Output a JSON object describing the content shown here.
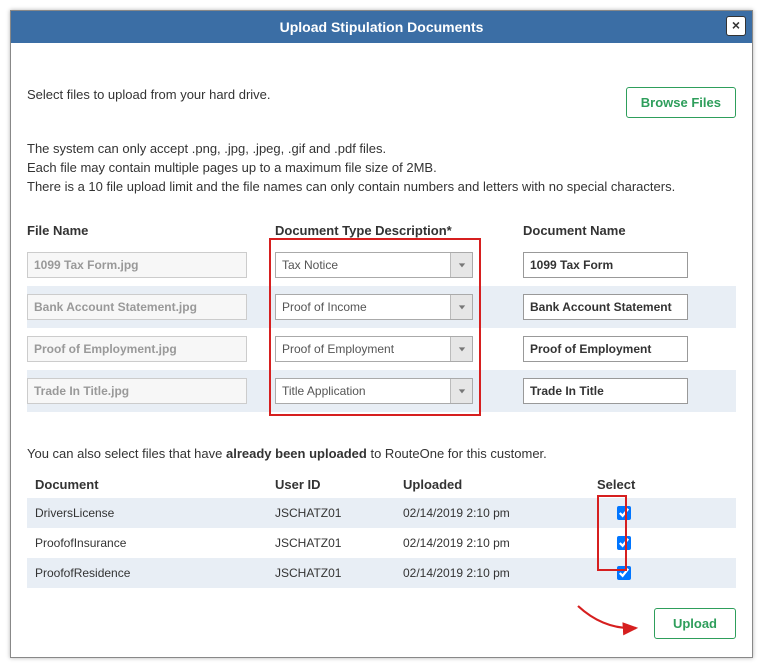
{
  "dialog": {
    "title": "Upload Stipulation Documents",
    "close_label": "×"
  },
  "intro": {
    "select_files": "Select files to upload from your hard drive.",
    "browse_label": "Browse Files",
    "line1": "The system can only accept .png, .jpg, .jpeg, .gif and .pdf files.",
    "line2": "Each file may contain multiple pages up to a maximum file size of 2MB.",
    "line3": "There is a 10 file upload limit and the file names can only contain numbers and letters with no special characters."
  },
  "file_table": {
    "headers": {
      "file_name": "File Name",
      "doc_type": "Document Type Description*",
      "doc_name": "Document Name"
    },
    "rows": [
      {
        "file": "1099 Tax Form.jpg",
        "type": "Tax Notice",
        "name": "1099 Tax Form"
      },
      {
        "file": "Bank Account Statement.jpg",
        "type": "Proof of Income",
        "name": "Bank Account Statement"
      },
      {
        "file": "Proof of Employment.jpg",
        "type": "Proof of Employment",
        "name": "Proof of Employment"
      },
      {
        "file": "Trade In Title.jpg",
        "type": "Title Application",
        "name": "Trade In Title"
      }
    ]
  },
  "already": {
    "intro_pre": "You can also select files that have ",
    "intro_bold": "already been uploaded",
    "intro_post": " to RouteOne for this customer.",
    "headers": {
      "doc": "Document",
      "user": "User ID",
      "upl": "Uploaded",
      "sel": "Select"
    },
    "rows": [
      {
        "doc": "DriversLicense",
        "user": "JSCHATZ01",
        "upl": "02/14/2019 2:10 pm",
        "checked": true
      },
      {
        "doc": "ProofofInsurance",
        "user": "JSCHATZ01",
        "upl": "02/14/2019 2:10 pm",
        "checked": true
      },
      {
        "doc": "ProofofResidence",
        "user": "JSCHATZ01",
        "upl": "02/14/2019 2:10 pm",
        "checked": true
      }
    ]
  },
  "footer": {
    "upload_label": "Upload"
  }
}
